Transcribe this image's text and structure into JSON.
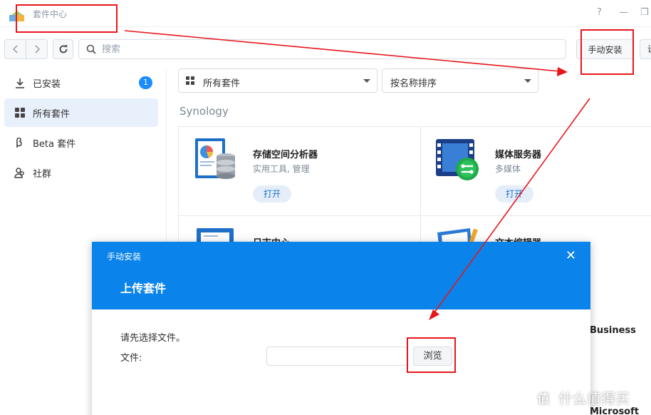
{
  "window": {
    "title": "套件中心",
    "help_glyph": "?",
    "minimize_glyph": "—",
    "restore_glyph": "❐"
  },
  "toolbar": {
    "search_placeholder": "搜索",
    "manual_install_label": "手动安装",
    "settings_label": "设"
  },
  "sidebar": {
    "items": [
      {
        "label": "已安装",
        "badge": "1",
        "icon": "download-icon"
      },
      {
        "label": "所有套件",
        "icon": "grid-icon",
        "active": true
      },
      {
        "label": "Beta 套件",
        "icon": "beta-icon"
      },
      {
        "label": "社群",
        "icon": "community-icon"
      }
    ]
  },
  "filters": {
    "category": "所有套件",
    "sort": "按名称排序"
  },
  "section_title": "Synology",
  "packages": [
    {
      "name": "存储空间分析器",
      "category": "实用工具, 管理",
      "open_label": "打开",
      "icon": "storage-analyzer-icon"
    },
    {
      "name": "媒体服务器",
      "category": "多媒体",
      "open_label": "打开",
      "icon": "media-server-icon"
    },
    {
      "name": "日志中心",
      "icon": "log-center-icon"
    },
    {
      "name": "文本编辑器",
      "icon": "text-editor-icon"
    }
  ],
  "right_column": {
    "business_label": "Business",
    "microsoft_label": "Microsoft"
  },
  "dialog": {
    "small_title": "手动安装",
    "close_glyph": "✕",
    "title": "上传套件",
    "hint": "请先选择文件。",
    "file_label": "文件:",
    "file_value": "",
    "browse_label": "浏览"
  },
  "watermark": {
    "glyph": "值",
    "text": "什么值得买"
  },
  "colors": {
    "accent": "#0a83ea",
    "annotation": "#e8151b"
  }
}
